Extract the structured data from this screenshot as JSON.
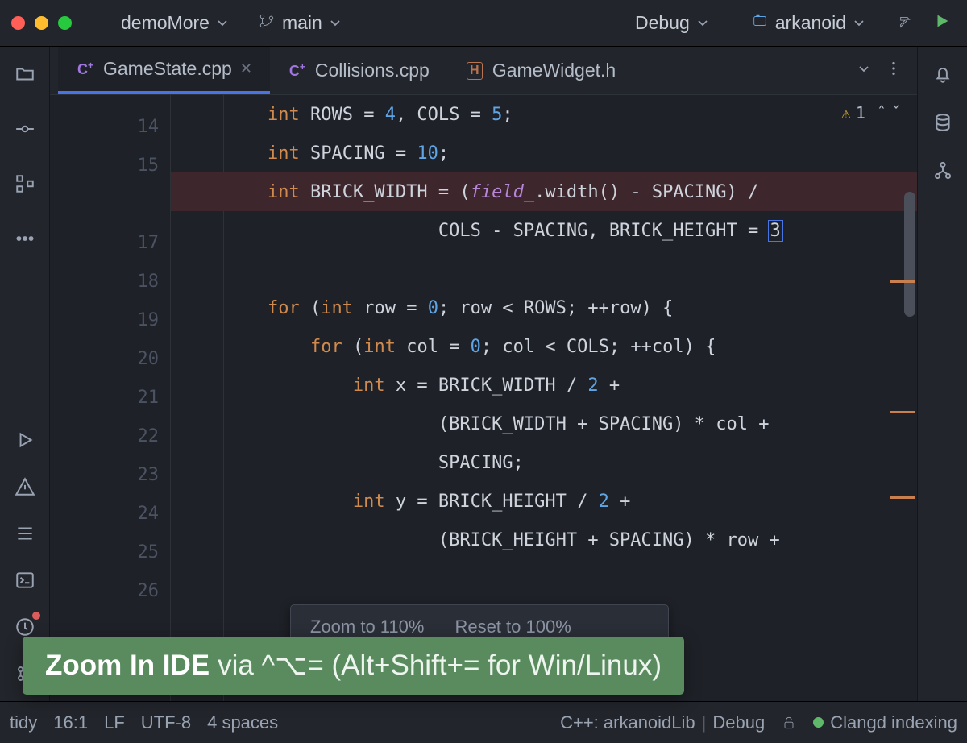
{
  "titlebar": {
    "project": "demoMore",
    "branch": "main",
    "config": "Debug",
    "target": "arkanoid"
  },
  "tabs": [
    {
      "label": "GameState.cpp",
      "icon": "cpp"
    },
    {
      "label": "Collisions.cpp",
      "icon": "cpp"
    },
    {
      "label": "GameWidget.h",
      "icon": "h"
    }
  ],
  "warnings": {
    "count": "1"
  },
  "gutter": {
    "l0": "14",
    "l1": "15",
    "l2": "",
    "l3": "17",
    "l4": "18",
    "l5": "19",
    "l6": "20",
    "l7": "21",
    "l8": "22",
    "l9": "23",
    "l10": "24",
    "l11": "25",
    "l12": "26"
  },
  "code": {
    "l14": {
      "ind": "        ",
      "kw": "int",
      "rest": " ROWS = ",
      "n1": "4",
      "mid": ", COLS = ",
      "n2": "5",
      "end": ";"
    },
    "l15": {
      "ind": "        ",
      "kw": "int",
      "rest": " SPACING = ",
      "n1": "10",
      "end": ";"
    },
    "l16": {
      "ind": "        ",
      "kw": "int",
      "a": " BRICK_WIDTH = (",
      "f": "field_",
      "b": ".width() - SPACING) /"
    },
    "l17": {
      "ind": "                        ",
      "rest": "COLS - SPACING, BRICK_HEIGHT = ",
      "sel": "3"
    },
    "l19": {
      "ind": "        ",
      "kw": "for",
      "a": " (",
      "kw2": "int",
      "b": " row = ",
      "n": "0",
      "c": "; row < ROWS; ++row) {"
    },
    "l20": {
      "ind": "            ",
      "kw": "for",
      "a": " (",
      "kw2": "int",
      "b": " col = ",
      "n": "0",
      "c": "; col < COLS; ++col) {"
    },
    "l21": {
      "ind": "                ",
      "kw": "int",
      "a": " x = BRICK_WIDTH / ",
      "n": "2",
      "b": " +"
    },
    "l22": {
      "ind": "                        ",
      "rest": "(BRICK_WIDTH + SPACING) * col +"
    },
    "l23": {
      "ind": "                        ",
      "rest": "SPACING;"
    },
    "l24": {
      "ind": "                ",
      "kw": "int",
      "a": " y = BRICK_HEIGHT / ",
      "n": "2",
      "b": " +"
    },
    "l25": {
      "ind": "                        ",
      "rest": "(BRICK_HEIGHT + SPACING) * row +"
    }
  },
  "popup": {
    "opt1": "Zoom to 110%",
    "opt2": "Reset to 100%"
  },
  "overlay": {
    "bold": "Zoom In IDE",
    "rest": " via ^⌥= (Alt+Shift+= for Win/Linux)"
  },
  "statusbar": {
    "tidy": "tidy",
    "pos": "16:1",
    "le": "LF",
    "enc": "UTF-8",
    "indent": "4 spaces",
    "ctx": "C++: arkanoidLib",
    "cfg": "Debug",
    "clangd": "Clangd indexing"
  }
}
